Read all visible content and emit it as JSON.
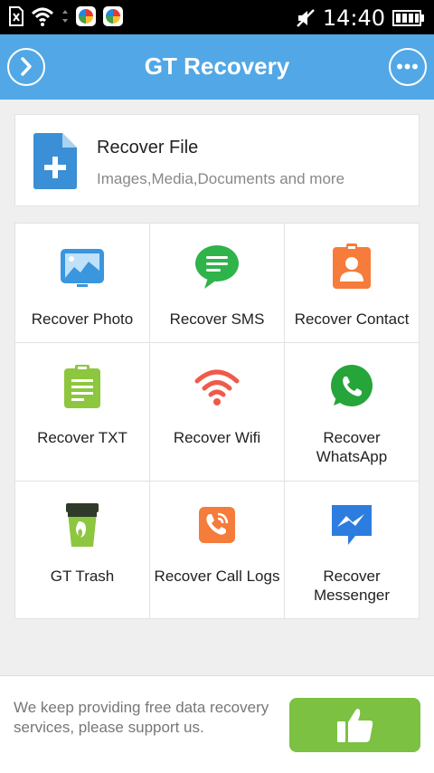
{
  "status_bar": {
    "time": "14:40"
  },
  "header": {
    "title": "GT Recovery"
  },
  "recover_file": {
    "title": "Recover File",
    "subtitle": "Images,Media,Documents and more"
  },
  "grid": {
    "photo": "Recover Photo",
    "sms": "Recover SMS",
    "contact": "Recover Contact",
    "txt": "Recover TXT",
    "wifi": "Recover Wifi",
    "whatsapp": "Recover WhatsApp",
    "trash": "GT Trash",
    "call_logs": "Recover Call Logs",
    "messenger": "Recover Messenger"
  },
  "footer": {
    "message": "We keep providing free data recovery services, please support us."
  },
  "colors": {
    "header": "#52a8e6",
    "like_button": "#7cc142",
    "photo_icon": "#3a96dd",
    "sms_icon": "#2fb34a",
    "contact_icon": "#f57c3a",
    "txt_icon": "#8dc63f",
    "wifi_icon": "#ef5a4a",
    "whatsapp_icon": "#25a53a",
    "call_icon": "#f57c3a",
    "messenger_icon": "#2d7de0"
  }
}
